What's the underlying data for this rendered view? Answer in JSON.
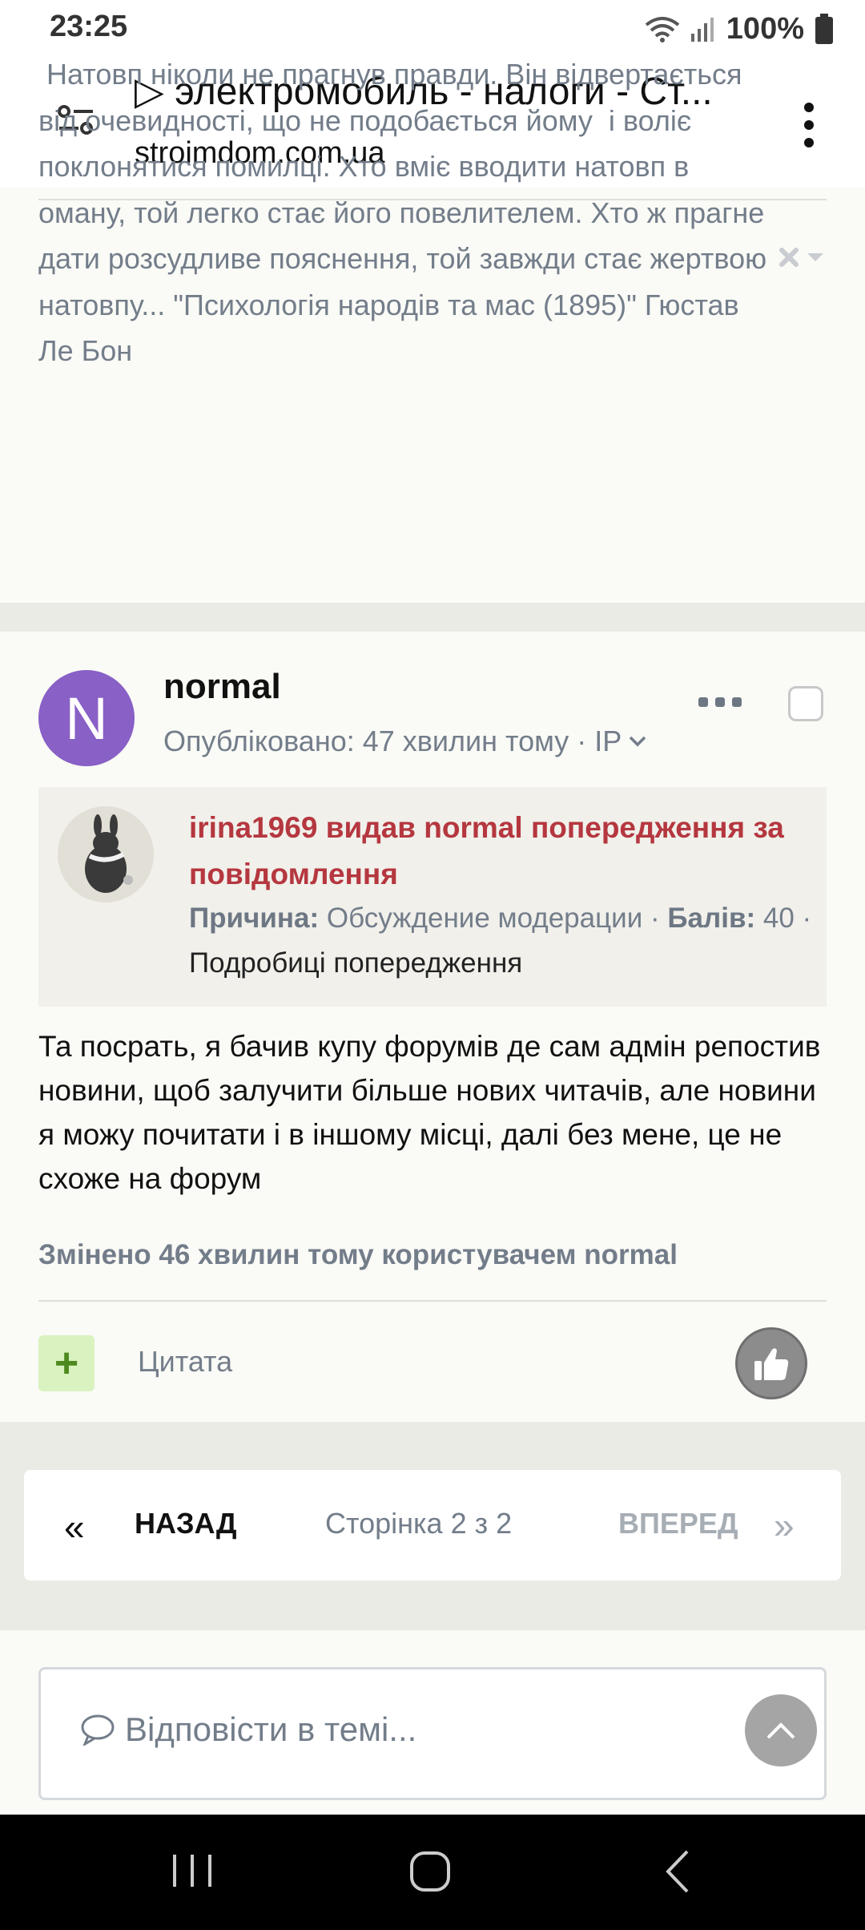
{
  "status_bar": {
    "time": "23:25",
    "battery_percent": "100%"
  },
  "browser": {
    "tab_title": "▷ электромобиль - налоги - Ст...",
    "domain": "stroimdom.com.ua"
  },
  "signature": {
    "text": " Натовп ніколи не прагнув правди. Він відвертається від очевидності, що не подобається йому  і волiє поклонятися помилці. Хто вміє вводити натовп в оману, той легко стає його повелителем. Хто ж прагне дати розсудливе пояснення, той завжди стає жертвою натовпу... \"Психологія народів та мас (1895)\" Гюстав Ле Бон"
  },
  "post": {
    "avatar_letter": "N",
    "author": "normal",
    "meta": "Опубліковано: 47 хвилин тому · IP",
    "warning": {
      "title": "irina1969 видав normal попередження за повідомлення",
      "reason_label": "Причина:",
      "reason_value": "Обсуждение модерации ·",
      "points_label": "Балів:",
      "points_value": "40 ·",
      "details_link": "Подробиці попередження"
    },
    "body": "Та посрать, я бачив купу форумів де сам адмін репостив новини, щоб залучити більше нових читачів, але новини я можу почитати і в іншому місці, далі без мене, це не схоже на форум",
    "edited": "Змінено 46 хвилин тому користувачем normal",
    "add_button": "+",
    "quote_label": "Цитата"
  },
  "pagination": {
    "prev_arrow": "«",
    "back_label": "НАЗАД",
    "page_info": "Сторінка 2 з 2",
    "forward_label": "ВПЕРЕД",
    "next_arrow": "»"
  },
  "reply": {
    "placeholder": "Відповісти в темі..."
  },
  "icons": {
    "tune": "tune-icon",
    "kebab": "kebab-menu-icon",
    "more": "more-dots-icon",
    "like": "thumbs-up-icon",
    "comment": "comment-icon",
    "scroll_top": "chevron-up-icon"
  },
  "colors": {
    "avatar": "#8860c6",
    "warning_title": "#b5373f",
    "muted": "#737d8a",
    "plus_bg": "#d9f2bf",
    "plus_fg": "#4e8a1f"
  }
}
